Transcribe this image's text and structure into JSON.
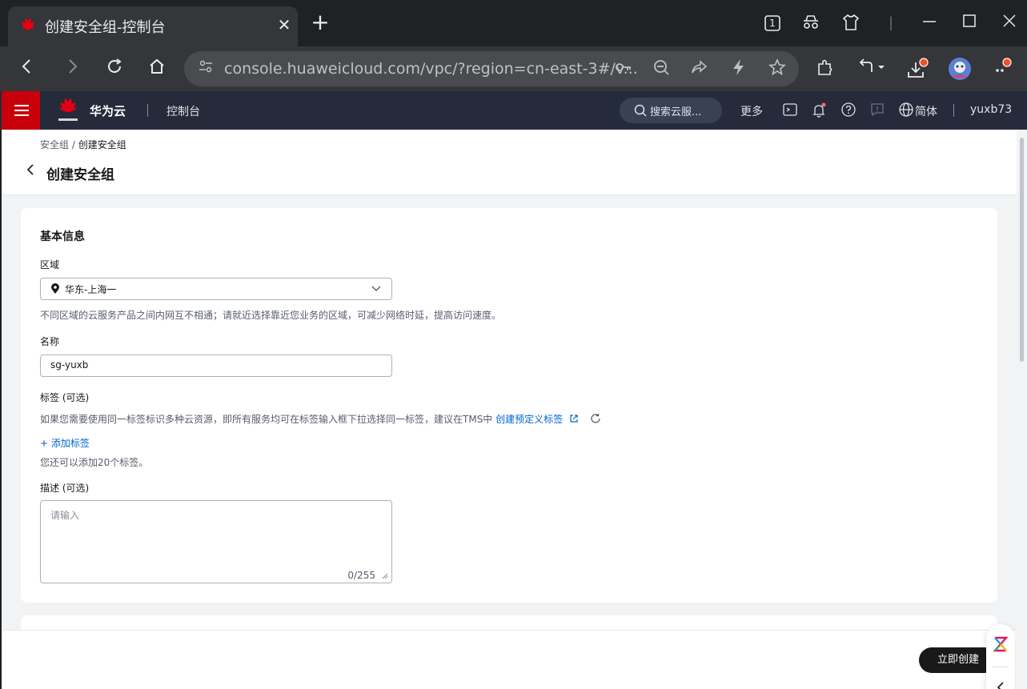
{
  "browser": {
    "tab_title": "创建安全组-控制台",
    "tab_count": "1",
    "url": "console.huaweicloud.com/vpc/?region=cn-east-3#/v..."
  },
  "header": {
    "brand": "华为云",
    "console": "控制台",
    "search_placeholder": "搜索云服...",
    "more": "更多",
    "language": "简体",
    "user": "yuxb73",
    "accent_color": "#c7000b"
  },
  "breadcrumb": {
    "parent": "安全组",
    "separator": " / ",
    "current": "创建安全组"
  },
  "page_title": "创建安全组",
  "form": {
    "section_title": "基本信息",
    "region": {
      "label": "区域",
      "value": "华东-上海一",
      "hint": "不同区域的云服务产品之间内网互不相通；请就近选择靠近您业务的区域，可减少网络时延，提高访问速度。"
    },
    "name": {
      "label": "名称",
      "value": "sg-yuxb"
    },
    "tags": {
      "label": "标签 (可选)",
      "hint": "如果您需要使用同一标签标识多种云资源，即所有服务均可在标签输入框下拉选择同一标签，建议在TMS中",
      "link": "创建预定义标签",
      "add": "+ 添加标签",
      "remaining": "您还可以添加20个标签。"
    },
    "description": {
      "label": "描述 (可选)",
      "placeholder": "请输入",
      "count": "0/255"
    }
  },
  "footer": {
    "create_button": "立即创建"
  }
}
